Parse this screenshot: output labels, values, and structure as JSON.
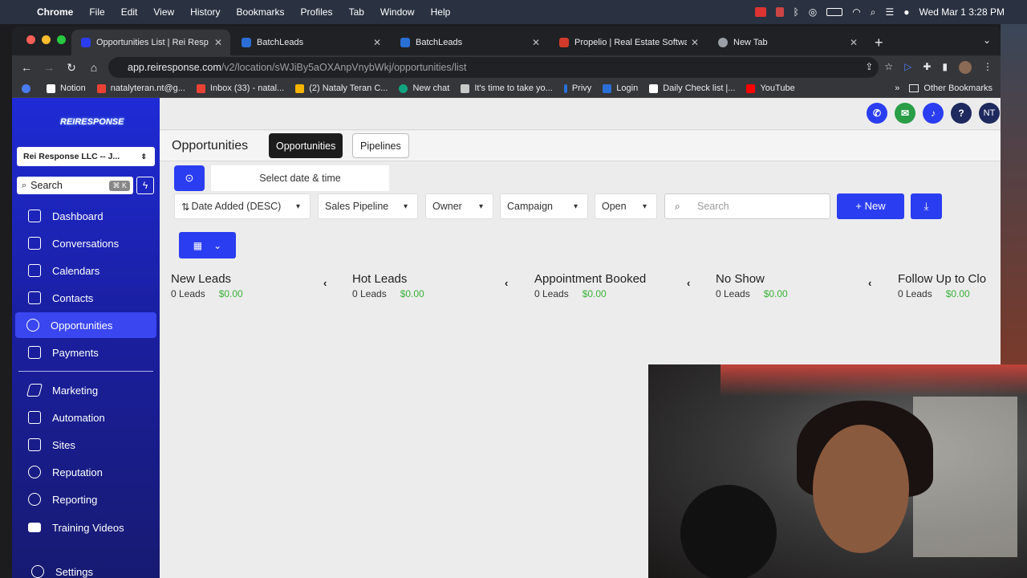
{
  "menubar": {
    "app": "Chrome",
    "items": [
      "File",
      "Edit",
      "View",
      "History",
      "Bookmarks",
      "Profiles",
      "Tab",
      "Window",
      "Help"
    ],
    "clock": "Wed Mar 1  3:28 PM"
  },
  "browser": {
    "tabs": [
      {
        "title": "Opportunities List | Rei Respon",
        "icon_color": "#2b3df0",
        "active": true
      },
      {
        "title": "BatchLeads",
        "icon_color": "#2a6fd6",
        "active": false
      },
      {
        "title": "BatchLeads",
        "icon_color": "#2a6fd6",
        "active": false
      },
      {
        "title": "Propelio | Real Estate Software",
        "icon_color": "#d23b2b",
        "active": false
      },
      {
        "title": "New Tab",
        "icon_color": "#9aa0a6",
        "active": false
      }
    ],
    "url_host": "app.reiresponse.com",
    "url_path": "/v2/location/sWJiBy5aOXAnpVnybWkj/opportunities/list",
    "bookmarks": [
      {
        "label": "Notion",
        "icon_color": "#ffffff"
      },
      {
        "label": "natalyteran.nt@g...",
        "icon_color": "#e94235"
      },
      {
        "label": "Inbox (33) - natal...",
        "icon_color": "#e94235"
      },
      {
        "label": "(2) Nataly Teran C...",
        "icon_color": "#f5b400"
      },
      {
        "label": "New chat",
        "icon_color": "#10a37f"
      },
      {
        "label": "It's time to take yo...",
        "icon_color": "#c9c9c9"
      },
      {
        "label": "Privy",
        "icon_color": "#2a6fd6"
      },
      {
        "label": "Login",
        "icon_color": "#2a6fd6"
      },
      {
        "label": "Daily Check list |...",
        "icon_color": "#ffffff"
      },
      {
        "label": "YouTube",
        "icon_color": "#ff0000"
      }
    ],
    "other_bookmarks": "Other Bookmarks"
  },
  "sidebar": {
    "logo": "REIRESPONSE",
    "account": "Rei Response LLC -- J...",
    "search_label": "Search",
    "search_shortcut": "⌘ K",
    "items": [
      {
        "label": "Dashboard",
        "active": false
      },
      {
        "label": "Conversations",
        "active": false
      },
      {
        "label": "Calendars",
        "active": false
      },
      {
        "label": "Contacts",
        "active": false
      },
      {
        "label": "Opportunities",
        "active": true
      },
      {
        "label": "Payments",
        "active": false
      },
      {
        "label": "Marketing",
        "active": false
      },
      {
        "label": "Automation",
        "active": false
      },
      {
        "label": "Sites",
        "active": false
      },
      {
        "label": "Reputation",
        "active": false
      },
      {
        "label": "Reporting",
        "active": false
      },
      {
        "label": "Training Videos",
        "active": false
      },
      {
        "label": "Settings",
        "active": false
      }
    ]
  },
  "topbar": {
    "avatar_initials": "NT",
    "help_label": "?"
  },
  "page": {
    "title": "Opportunities",
    "tab_opportunities": "Opportunities",
    "tab_pipelines": "Pipelines",
    "date_placeholder": "Select date & time",
    "filters": {
      "sort": "Date Added (DESC)",
      "pipeline": "Sales Pipeline",
      "owner": "Owner",
      "campaign": "Campaign",
      "status": "Open"
    },
    "search_placeholder": "Search",
    "new_button": "New"
  },
  "stages": [
    {
      "name": "New Leads",
      "count": "0 Leads",
      "value": "$0.00"
    },
    {
      "name": "Hot Leads",
      "count": "0 Leads",
      "value": "$0.00"
    },
    {
      "name": "Appointment Booked",
      "count": "0 Leads",
      "value": "$0.00"
    },
    {
      "name": "No Show",
      "count": "0 Leads",
      "value": "$0.00"
    },
    {
      "name": "Follow Up to Clo",
      "count": "0 Leads",
      "value": "$0.00"
    }
  ],
  "colors": {
    "primary": "#2b3df0",
    "success": "#3ab23a",
    "sidebar": "#1a1fa0"
  }
}
